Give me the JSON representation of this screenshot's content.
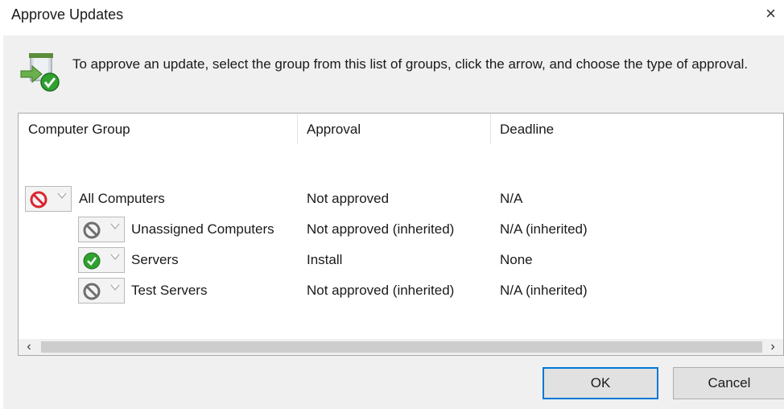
{
  "window": {
    "title": "Approve Updates",
    "close_glyph": "×"
  },
  "intro": {
    "icon": "approve-update-icon",
    "text": "To approve an update, select the group from this list of groups, click the arrow, and choose the type of approval."
  },
  "table": {
    "headers": {
      "group": "Computer Group",
      "approval": "Approval",
      "deadline": "Deadline"
    },
    "rows": [
      {
        "status_icon": "not-approved-red-icon",
        "group": "All Computers",
        "approval": "Not approved",
        "deadline": "N/A"
      },
      {
        "status_icon": "not-approved-gray-icon",
        "group": "Unassigned Computers",
        "approval": "Not approved (inherited)",
        "deadline": "N/A (inherited)"
      },
      {
        "status_icon": "install-check-icon",
        "group": "Servers",
        "approval": "Install",
        "deadline": "None"
      },
      {
        "status_icon": "not-approved-gray-icon",
        "group": "Test Servers",
        "approval": "Not approved (inherited)",
        "deadline": "N/A (inherited)"
      }
    ]
  },
  "scrollbar": {
    "left_glyph": "‹",
    "right_glyph": "›"
  },
  "buttons": {
    "ok": "OK",
    "cancel": "Cancel"
  },
  "colors": {
    "accent": "#0078d7",
    "dialog_bg": "#f0f0f0",
    "not_approved": "#d9262f",
    "install": "#2fa12f"
  }
}
